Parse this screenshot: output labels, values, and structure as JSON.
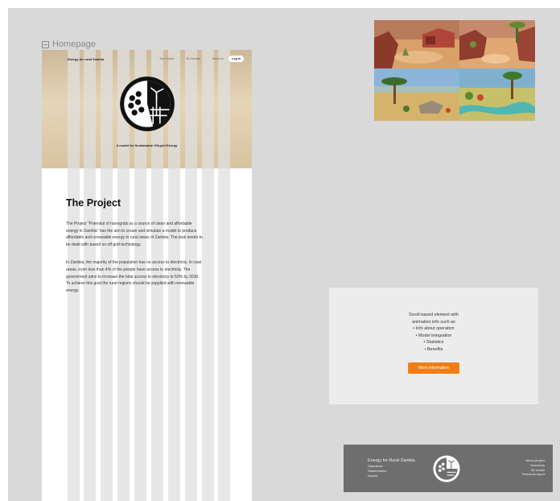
{
  "frame_label": "Homepage",
  "site": {
    "brand": "Energy for rural Zambia",
    "nav_links": [
      "The Project",
      "3D Models",
      "About us"
    ],
    "login": "Log in",
    "tagline": "A model for Sustainable Off-grid Energy"
  },
  "project": {
    "title": "The Project",
    "paragraphs": [
      "The Project \"Potential of nanogrids as a source of clean and affordable energy in Zambia\" has the aim to create and simulate a model to produce affordable and renewable energy in rural areas of Zambia. The task needs to be dealt with based on off-grid technology.",
      "In Zambia, the majority of the population has no access to electricity. In rural areas, even less than 4% of the people have access to electricity. The government aims to increase the total access to electricity to 50% by 2030. To achieve this goal the rural regions should be supplied with renewable energy."
    ]
  },
  "info_box": {
    "intro_line1": "Scroll-based element with",
    "intro_line2": "animation info such as",
    "items": [
      "Info about operation",
      "Model integration",
      "Statistics",
      "Benefits"
    ],
    "button": "More information"
  },
  "footer": {
    "title": "Energy for Rural Zambia",
    "left_links": [
      "Objectives",
      "Stakeholders",
      "Imprint"
    ],
    "right_links": [
      "About project",
      "Scenarios",
      "3D model",
      "Technical report"
    ]
  },
  "colors": {
    "accent": "#f07d16",
    "canvas": "#d9d9d9",
    "footer": "#6e6e6e"
  }
}
